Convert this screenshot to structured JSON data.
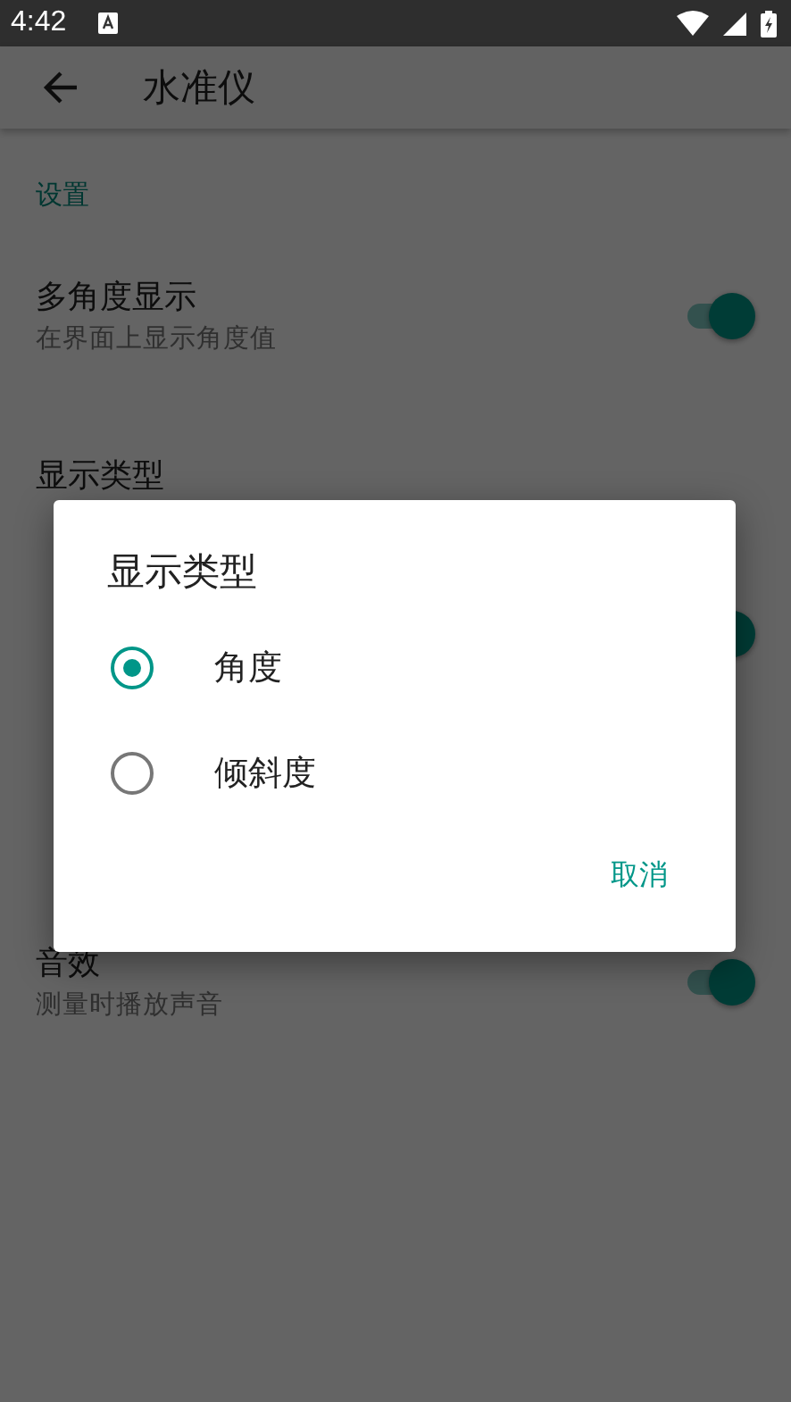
{
  "status_bar": {
    "time": "4:42"
  },
  "app_bar": {
    "title": "水准仪"
  },
  "section": {
    "title": "设置"
  },
  "settings": [
    {
      "kind": "switch",
      "title": "多角度显示",
      "subtitle": "在界面上显示角度值",
      "on": true
    },
    {
      "kind": "text",
      "title": "显示类型"
    },
    {
      "kind": "switch",
      "on": true
    },
    {
      "kind": "switch",
      "title": "音效",
      "subtitle": "测量时播放声音",
      "on": true
    }
  ],
  "dialog": {
    "title": "显示类型",
    "options": [
      {
        "label": "角度",
        "selected": true
      },
      {
        "label": "倾斜度",
        "selected": false
      }
    ],
    "button": "取消"
  }
}
